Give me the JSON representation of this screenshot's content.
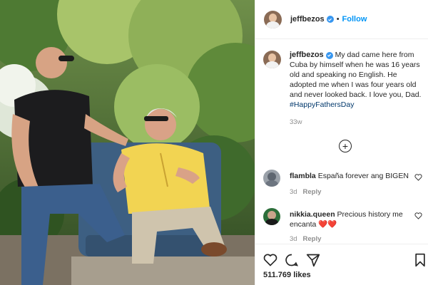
{
  "post": {
    "username": "jeffbezos",
    "follow_label": "Follow",
    "dot": "•",
    "caption_username": "jeffbezos",
    "caption_text": " My dad came here from Cuba by himself when he was 16 years old and speaking no English. He adopted me when I was four years old and never looked back. I love you, Dad. ",
    "hashtag": "#HappyFathersDay",
    "caption_time": "33w",
    "load_more_symbol": "+",
    "likes": "511.769 likes"
  },
  "comments": [
    {
      "username": "flambla",
      "text": "España forever ang BIGEN",
      "time": "3d",
      "reply_label": "Reply"
    },
    {
      "username": "nikkia.queen",
      "text": "Precious history me encanta",
      "emoji": "❤️❤️",
      "time": "3d",
      "reply_label": "Reply"
    }
  ],
  "icons": {
    "verified": "verified-badge-icon",
    "like": "heart-icon",
    "comment": "comment-icon",
    "share": "send-icon",
    "save": "bookmark-icon",
    "load_more": "plus-circle-icon"
  },
  "colors": {
    "link_blue": "#0095f6",
    "verified_blue": "#3897f0",
    "hashtag_blue": "#00376b",
    "muted_gray": "#8e8e8e",
    "emoji_red": "#e0245e"
  }
}
